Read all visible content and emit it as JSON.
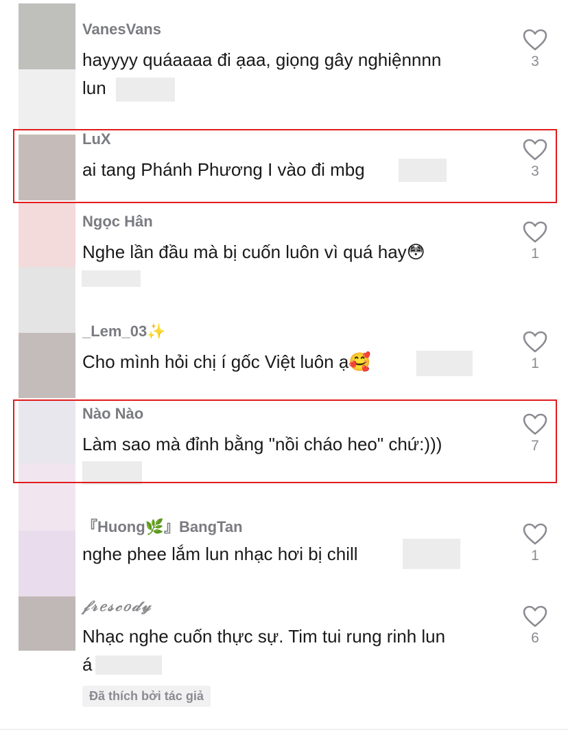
{
  "colors": {
    "highlight_border": "#e11b1b",
    "username": "#7a7b80",
    "comment_text": "#1a1a1a",
    "like_count": "#8a8b91"
  },
  "comments": [
    {
      "username": "VanesVans",
      "lines": [
        "hayyyy quáaaaa đi ạaa, giọng gây nghiệnnnn",
        "lun"
      ],
      "likes": "3",
      "highlighted": false
    },
    {
      "username": "LuX",
      "lines": [
        "ai tang Phánh Phương I vào đi mbg"
      ],
      "likes": "3",
      "highlighted": true
    },
    {
      "username": "Ngọc Hân",
      "lines": [
        "Nghe lần đầu mà bị cuốn luôn vì quá hay😳"
      ],
      "likes": "1",
      "highlighted": false
    },
    {
      "username": "_Lem_03✨",
      "lines": [
        "Cho mình hỏi chị í gốc Việt luôn ạ🥰"
      ],
      "likes": "1",
      "highlighted": false
    },
    {
      "username": "Nào Nào",
      "lines": [
        "Làm sao mà đỉnh bằng \"nồi cháo heo\" chứ:)))"
      ],
      "likes": "7",
      "highlighted": true
    },
    {
      "username": "『Huong🌿』BangTan",
      "lines": [
        "nghe phee lắm lun nhạc hơi bị chill"
      ],
      "likes": "1",
      "highlighted": false
    },
    {
      "username": "𝒻𝓇𝑒𝓈𝒸𝑜𝒹𝓎",
      "lines": [
        "Nhạc nghe cuốn thực sự. Tim tui rung rinh lun",
        "á"
      ],
      "likes": "6",
      "highlighted": false,
      "badge": "Đã thích bởi tác giả"
    }
  ]
}
